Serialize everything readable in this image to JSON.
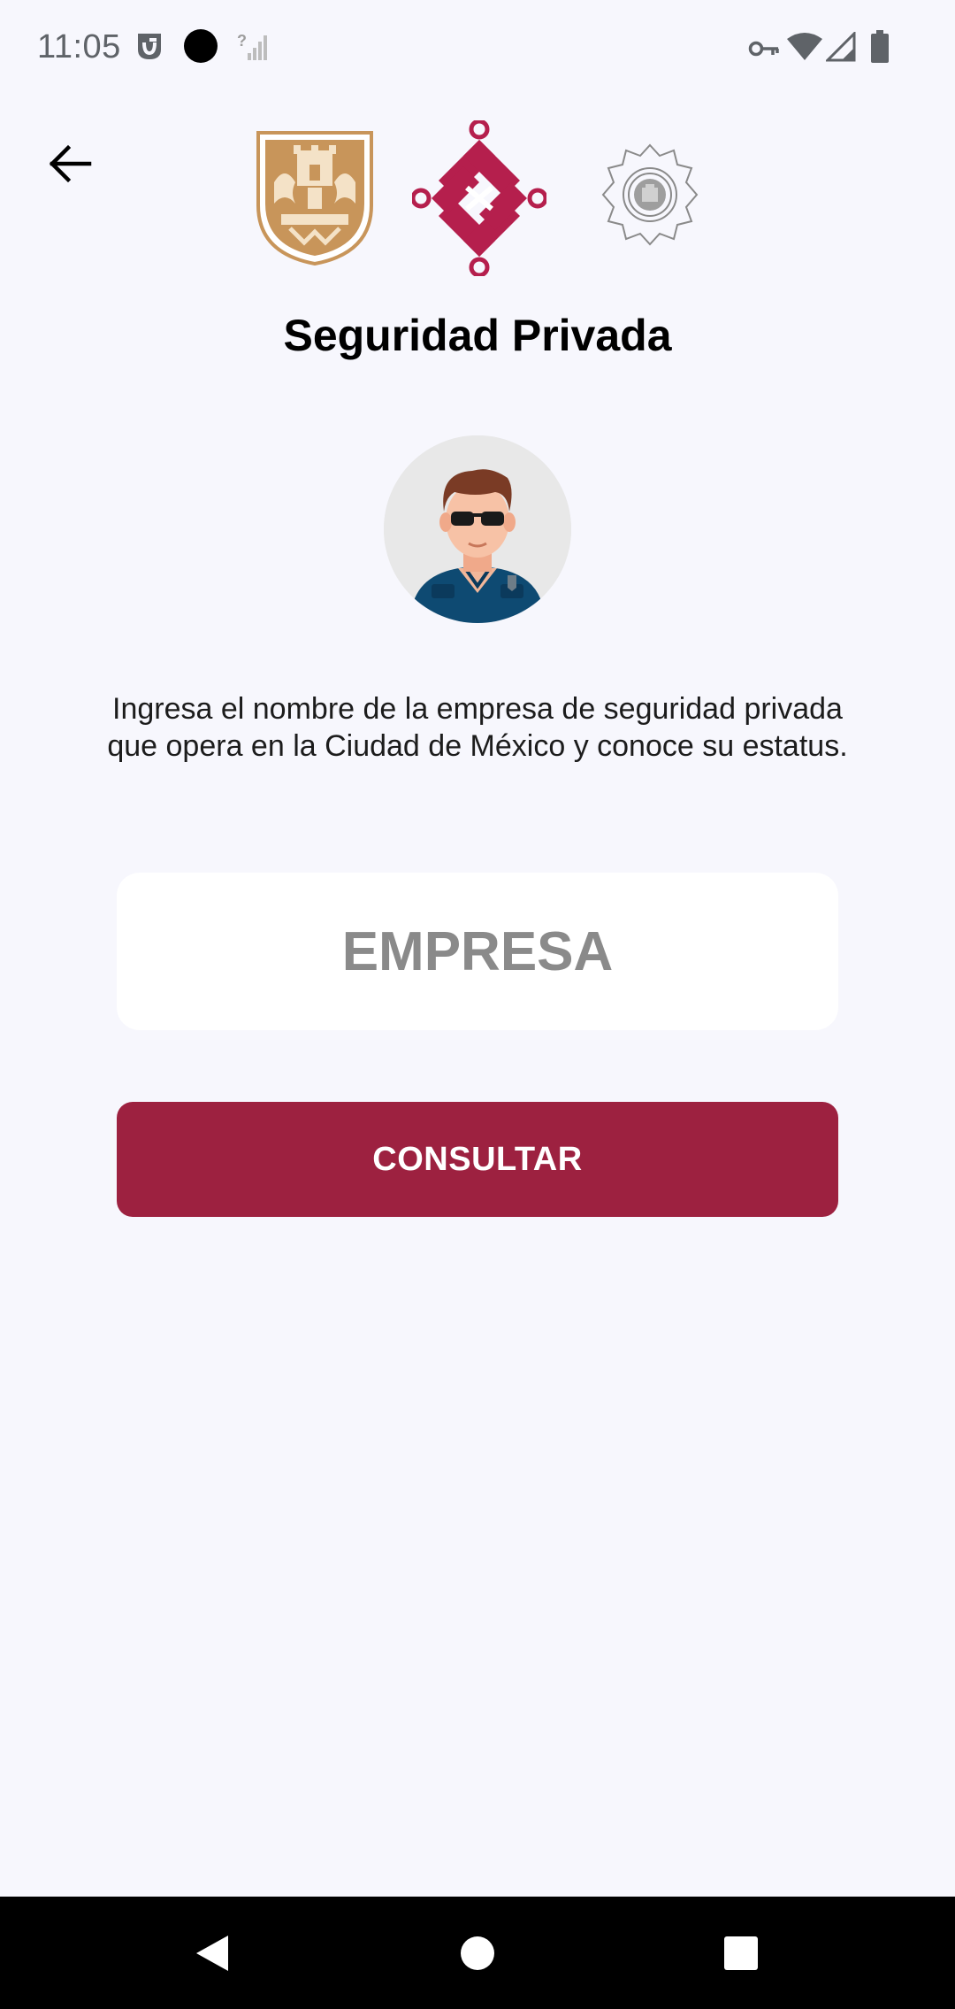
{
  "status_bar": {
    "time": "11:05",
    "icons": [
      "notification-app-icon",
      "dot-icon",
      "no-signal-icon",
      "vpn-key-icon",
      "wifi-icon",
      "cell-signal-icon",
      "battery-icon"
    ]
  },
  "header": {
    "back_icon": "arrow-back-icon",
    "logos": [
      "cdmx-coat-of-arms-logo",
      "cdmx-government-logo",
      "police-badge-logo"
    ],
    "title": "Seguridad Privada"
  },
  "main": {
    "avatar": "security-guard-avatar",
    "description": "Ingresa el nombre de la empresa de seguridad privada que opera en la Ciudad de México y conoce su estatus.",
    "company_input": {
      "value": "",
      "placeholder": "EMPRESA"
    },
    "submit_label": "CONSULTAR"
  },
  "nav_bar": {
    "buttons": [
      "back-triangle-icon",
      "home-circle-icon",
      "recents-square-icon"
    ]
  },
  "colors": {
    "background": "#f7f7fd",
    "accent": "#9d2140",
    "gold": "#c8955a",
    "input_background": "#ffffff",
    "nav_bar": "#000000"
  }
}
